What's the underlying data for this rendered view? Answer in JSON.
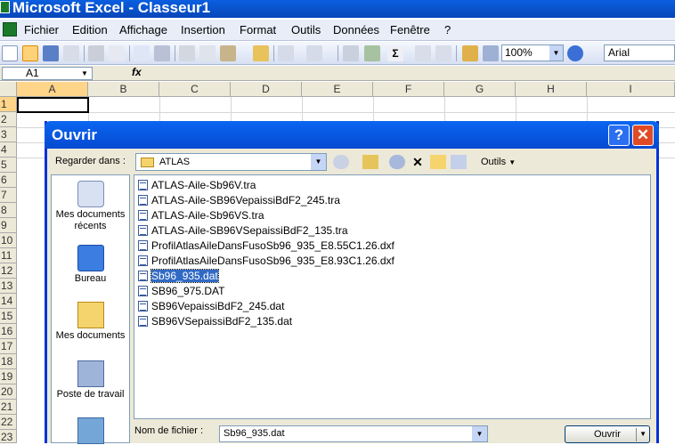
{
  "app": {
    "title": "Microsoft Excel - Classeur1"
  },
  "menu": [
    "Fichier",
    "Edition",
    "Affichage",
    "Insertion",
    "Format",
    "Outils",
    "Données",
    "Fenêtre",
    "?"
  ],
  "toolbar": {
    "zoom": "100%",
    "font": "Arial"
  },
  "formula": {
    "namebox": "A1",
    "fx": "fx"
  },
  "grid": {
    "columns": [
      "A",
      "B",
      "C",
      "D",
      "E",
      "F",
      "G",
      "H",
      "I"
    ],
    "rows": [
      "1",
      "2",
      "3",
      "4",
      "5",
      "6",
      "7",
      "8",
      "9",
      "10",
      "11",
      "12",
      "13",
      "14",
      "15",
      "16",
      "17",
      "18",
      "19",
      "20",
      "21",
      "22",
      "23"
    ]
  },
  "dialog": {
    "title": "Ouvrir",
    "help": "?",
    "close": "✕",
    "lookin_label": "Regarder dans :",
    "lookin_value": "ATLAS",
    "tools_label": "Outils",
    "places": [
      {
        "label": "Mes documents récents",
        "icon": "recent-docs-icon"
      },
      {
        "label": "Bureau",
        "icon": "desktop-icon"
      },
      {
        "label": "Mes documents",
        "icon": "my-documents-icon"
      },
      {
        "label": "Poste de travail",
        "icon": "my-computer-icon"
      },
      {
        "label": "",
        "icon": "network-icon"
      }
    ],
    "files": [
      "ATLAS-Aile-Sb96V.tra",
      "ATLAS-Aile-SB96VepaissiBdF2_245.tra",
      "ATLAS-Aile-Sb96VS.tra",
      "ATLAS-Aile-SB96VSepaissiBdF2_135.tra",
      "ProfilAtlasAileDansFusoSb96_935_E8.55C1.26.dxf",
      "ProfilAtlasAileDansFusoSb96_935_E8.93C1.26.dxf",
      "Sb96_935.dat",
      "SB96_975.DAT",
      "SB96VepaissiBdF2_245.dat",
      "SB96VSepaissiBdF2_135.dat"
    ],
    "selected_file": "Sb96_935.dat",
    "filename_label": "Nom de fichier :",
    "filename_value": "Sb96_935.dat",
    "open_button": "Ouvrir"
  }
}
